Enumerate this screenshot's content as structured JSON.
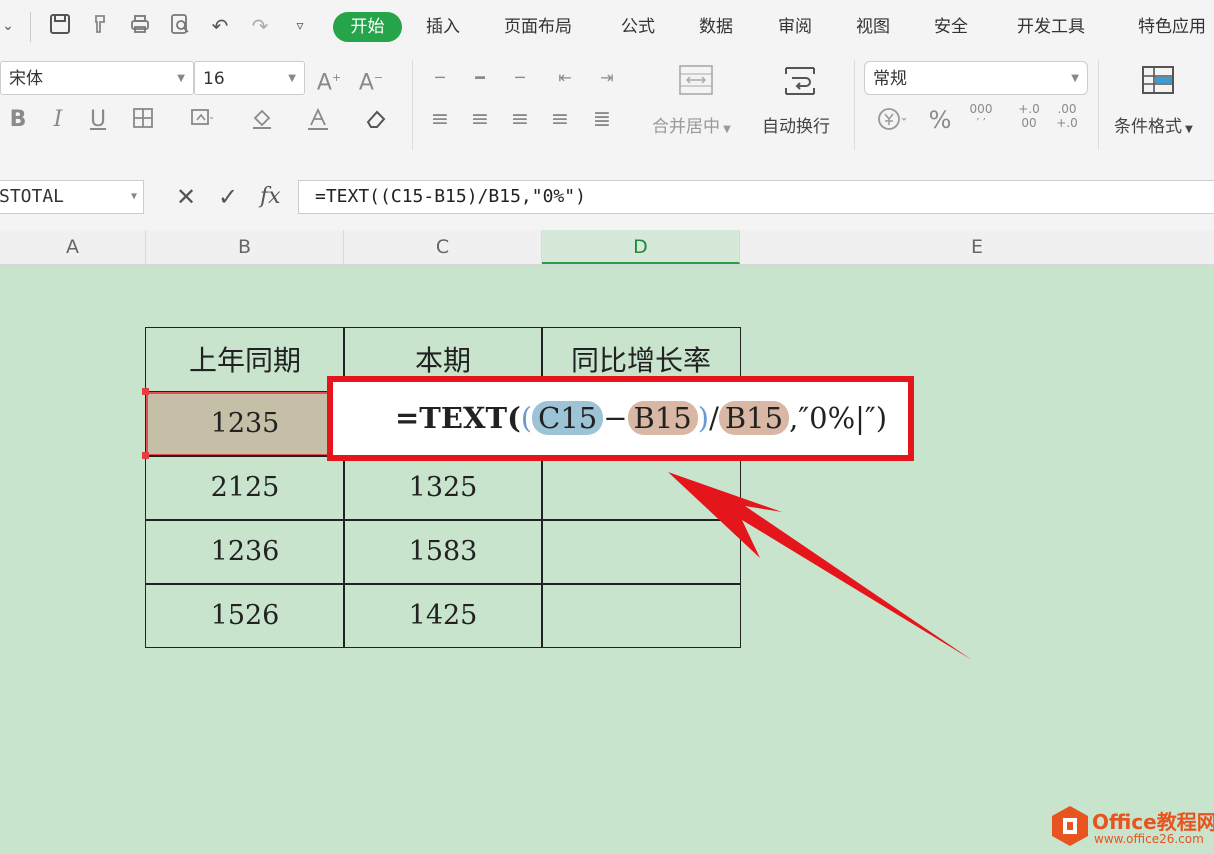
{
  "quick_access": {
    "icons": [
      "chevron-down-icon",
      "save-icon",
      "format-painter-icon",
      "print-icon",
      "print-preview-icon",
      "undo-icon",
      "redo-icon",
      "customize-icon"
    ]
  },
  "menu": {
    "tabs": [
      "开始",
      "插入",
      "页面布局",
      "公式",
      "数据",
      "审阅",
      "视图",
      "安全",
      "开发工具",
      "特色应用"
    ],
    "active_tab": "开始"
  },
  "ribbon": {
    "font_name": "宋体",
    "font_size": "16",
    "number_format": "常规",
    "merge_center": "合并居中",
    "wrap_text": "自动换行",
    "conditional_format": "条件格式",
    "bold": "B",
    "italic": "I",
    "underline": "U",
    "percent": "%",
    "thousands": "000",
    "decimal_add_top": "+.0",
    "decimal_add_bottom": "00",
    "decimal_remove_top": ".00",
    "decimal_remove_bottom": "+.0"
  },
  "formula_bar": {
    "name_box": "STOTAL",
    "fx_label": "fx",
    "formula": "=TEXT((C15-B15)/B15,\"0%\")"
  },
  "columns": [
    "A",
    "B",
    "C",
    "D",
    "E"
  ],
  "active_column": "D",
  "table": {
    "headers": [
      "上年同期",
      "本期",
      "同比增长率"
    ],
    "rows": [
      [
        "1235",
        "",
        ""
      ],
      [
        "2125",
        "1325",
        ""
      ],
      [
        "1236",
        "1583",
        ""
      ],
      [
        "1526",
        "1425",
        ""
      ]
    ]
  },
  "editing": {
    "prefix": "=TEXT(",
    "open_paren": "(",
    "ref1": "C15",
    "minus": "−",
    "ref2": "B15",
    "close_paren": ")",
    "slash": "/",
    "ref3": "B15",
    "tail": ",″0%|″)"
  },
  "watermark": {
    "brand": "Office教程网",
    "url": "www.office26.com"
  },
  "colors": {
    "accent_green": "#26a44a",
    "highlight_red": "#e4161b",
    "sheet_background": "#c9e4cd"
  }
}
